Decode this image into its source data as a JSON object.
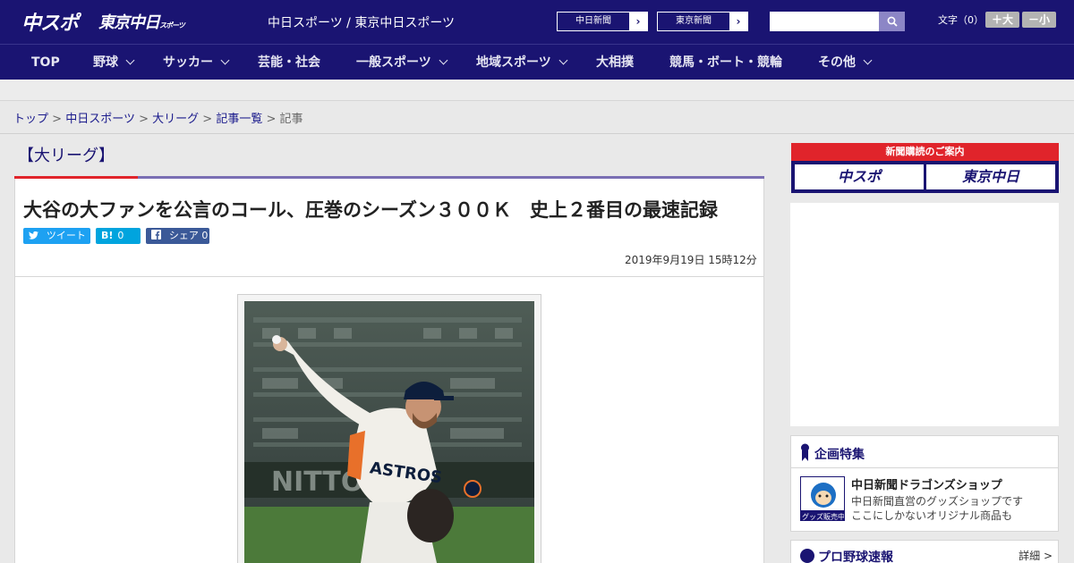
{
  "header": {
    "logo_chuspo": "中スポ",
    "logo_tokyo": "東京中日",
    "logo_tokyo_suffix": "スポーツ",
    "site_names": "中日スポーツ / 東京中日スポーツ",
    "paper_links": [
      {
        "label": "中日新聞"
      },
      {
        "label": "東京新聞"
      }
    ],
    "search_placeholder": "",
    "fontsize_label": "文字（0）",
    "font_larger": "＋大",
    "font_smaller": "－小"
  },
  "nav": {
    "items": [
      {
        "label": "TOP",
        "has_dropdown": false
      },
      {
        "label": "野球",
        "has_dropdown": true
      },
      {
        "label": "サッカー",
        "has_dropdown": true
      },
      {
        "label": "芸能・社会",
        "has_dropdown": false
      },
      {
        "label": "一般スポーツ",
        "has_dropdown": true
      },
      {
        "label": "地域スポーツ",
        "has_dropdown": true
      },
      {
        "label": "大相撲",
        "has_dropdown": false
      },
      {
        "label": "競馬・ボート・競輪",
        "has_dropdown": false
      },
      {
        "label": "その他",
        "has_dropdown": true
      }
    ]
  },
  "breadcrumb": {
    "items": [
      "トップ",
      "中日スポーツ",
      "大リーグ",
      "記事一覧"
    ],
    "current": "記事",
    "separator": ">"
  },
  "article": {
    "category": "【大リーグ】",
    "headline": "大谷の大ファンを公言のコール、圧巻のシーズン３００Ｋ　史上２番目の最速記録",
    "share": {
      "tweet_label": "ツイート",
      "hatena_label": "B!",
      "hatena_count": "0",
      "facebook_label": "シェア",
      "facebook_count": "0"
    },
    "date": "2019年9月19日 15時12分"
  },
  "sidebar": {
    "subscribe_title": "新聞購読のご案内",
    "subscribe_logo_1": "中スポ",
    "subscribe_logo_2": "東京中日",
    "feature_title": "企画特集",
    "shop_name": "中日新聞ドラゴンズショップ",
    "shop_desc_1": "中日新聞直営のグッズショップです",
    "shop_desc_2": "ここにしかないオリジナル商品も",
    "shop_badge": "グッズ販売中",
    "score_title": "プロ野球速報",
    "score_more": "詳細 >"
  },
  "colors": {
    "brand_navy": "#1a1472",
    "accent_red": "#e0242b",
    "twitter": "#1da1f2",
    "hatena": "#00a4de",
    "facebook": "#3b5998"
  },
  "icons": {
    "search": "search-icon",
    "paper_arrow": "chevron-right-icon",
    "nav_dropdown": "chevron-down-icon"
  }
}
